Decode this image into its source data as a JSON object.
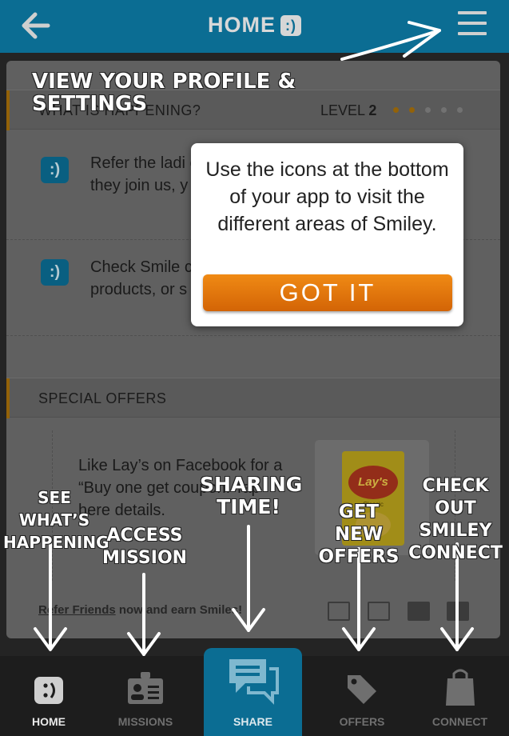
{
  "header": {
    "title": "HOME",
    "logo_glyph": ":)"
  },
  "sections": {
    "happening": {
      "title": "WHAT IS HAPPENING?",
      "level_label": "LEVEL",
      "level_value": "2",
      "dots_total": 5,
      "dots_filled": 2
    },
    "offers": {
      "title": "SPECIAL OFFERS"
    }
  },
  "items": [
    {
      "icon": ":)",
      "text": "Refer the ladi clude them i they join us, y"
    },
    {
      "icon": ":)",
      "text": "Check Smile community products, or s"
    }
  ],
  "offer": {
    "text": "Like Lay’s on Facebook for a “Buy one get coupon! Tap here details.",
    "product_brand": "Lay's",
    "product_variant": "Classic"
  },
  "refer": {
    "link": "Refer Friends",
    "rest": " now and earn Smiles!"
  },
  "popup": {
    "message": "Use the icons at the bottom of your app to visit the different areas of Smiley.",
    "button": "GOT IT"
  },
  "annotations": {
    "profile": "VIEW YOUR PROFILE & SETTINGS",
    "happening": "SEE WHAT’S HAPPENING",
    "mission": "ACCESS MISSION",
    "sharing": "SHARING TIME!",
    "offers": "GET NEW OFFERS",
    "connect": "CHECK OUT SMILEY CONNECT"
  },
  "tabs": [
    {
      "label": "HOME",
      "icon": "smiley-icon",
      "active": true
    },
    {
      "label": "MISSIONS",
      "icon": "id-badge-icon"
    },
    {
      "label": "SHARE",
      "icon": "chat-bubble-icon"
    },
    {
      "label": "OFFERS",
      "icon": "tag-icon"
    },
    {
      "label": "CONNECT",
      "icon": "shopping-bag-icon"
    }
  ],
  "colors": {
    "brand_blue": "#0b6d93",
    "accent_orange": "#e8750d",
    "gold": "#a8700a"
  }
}
